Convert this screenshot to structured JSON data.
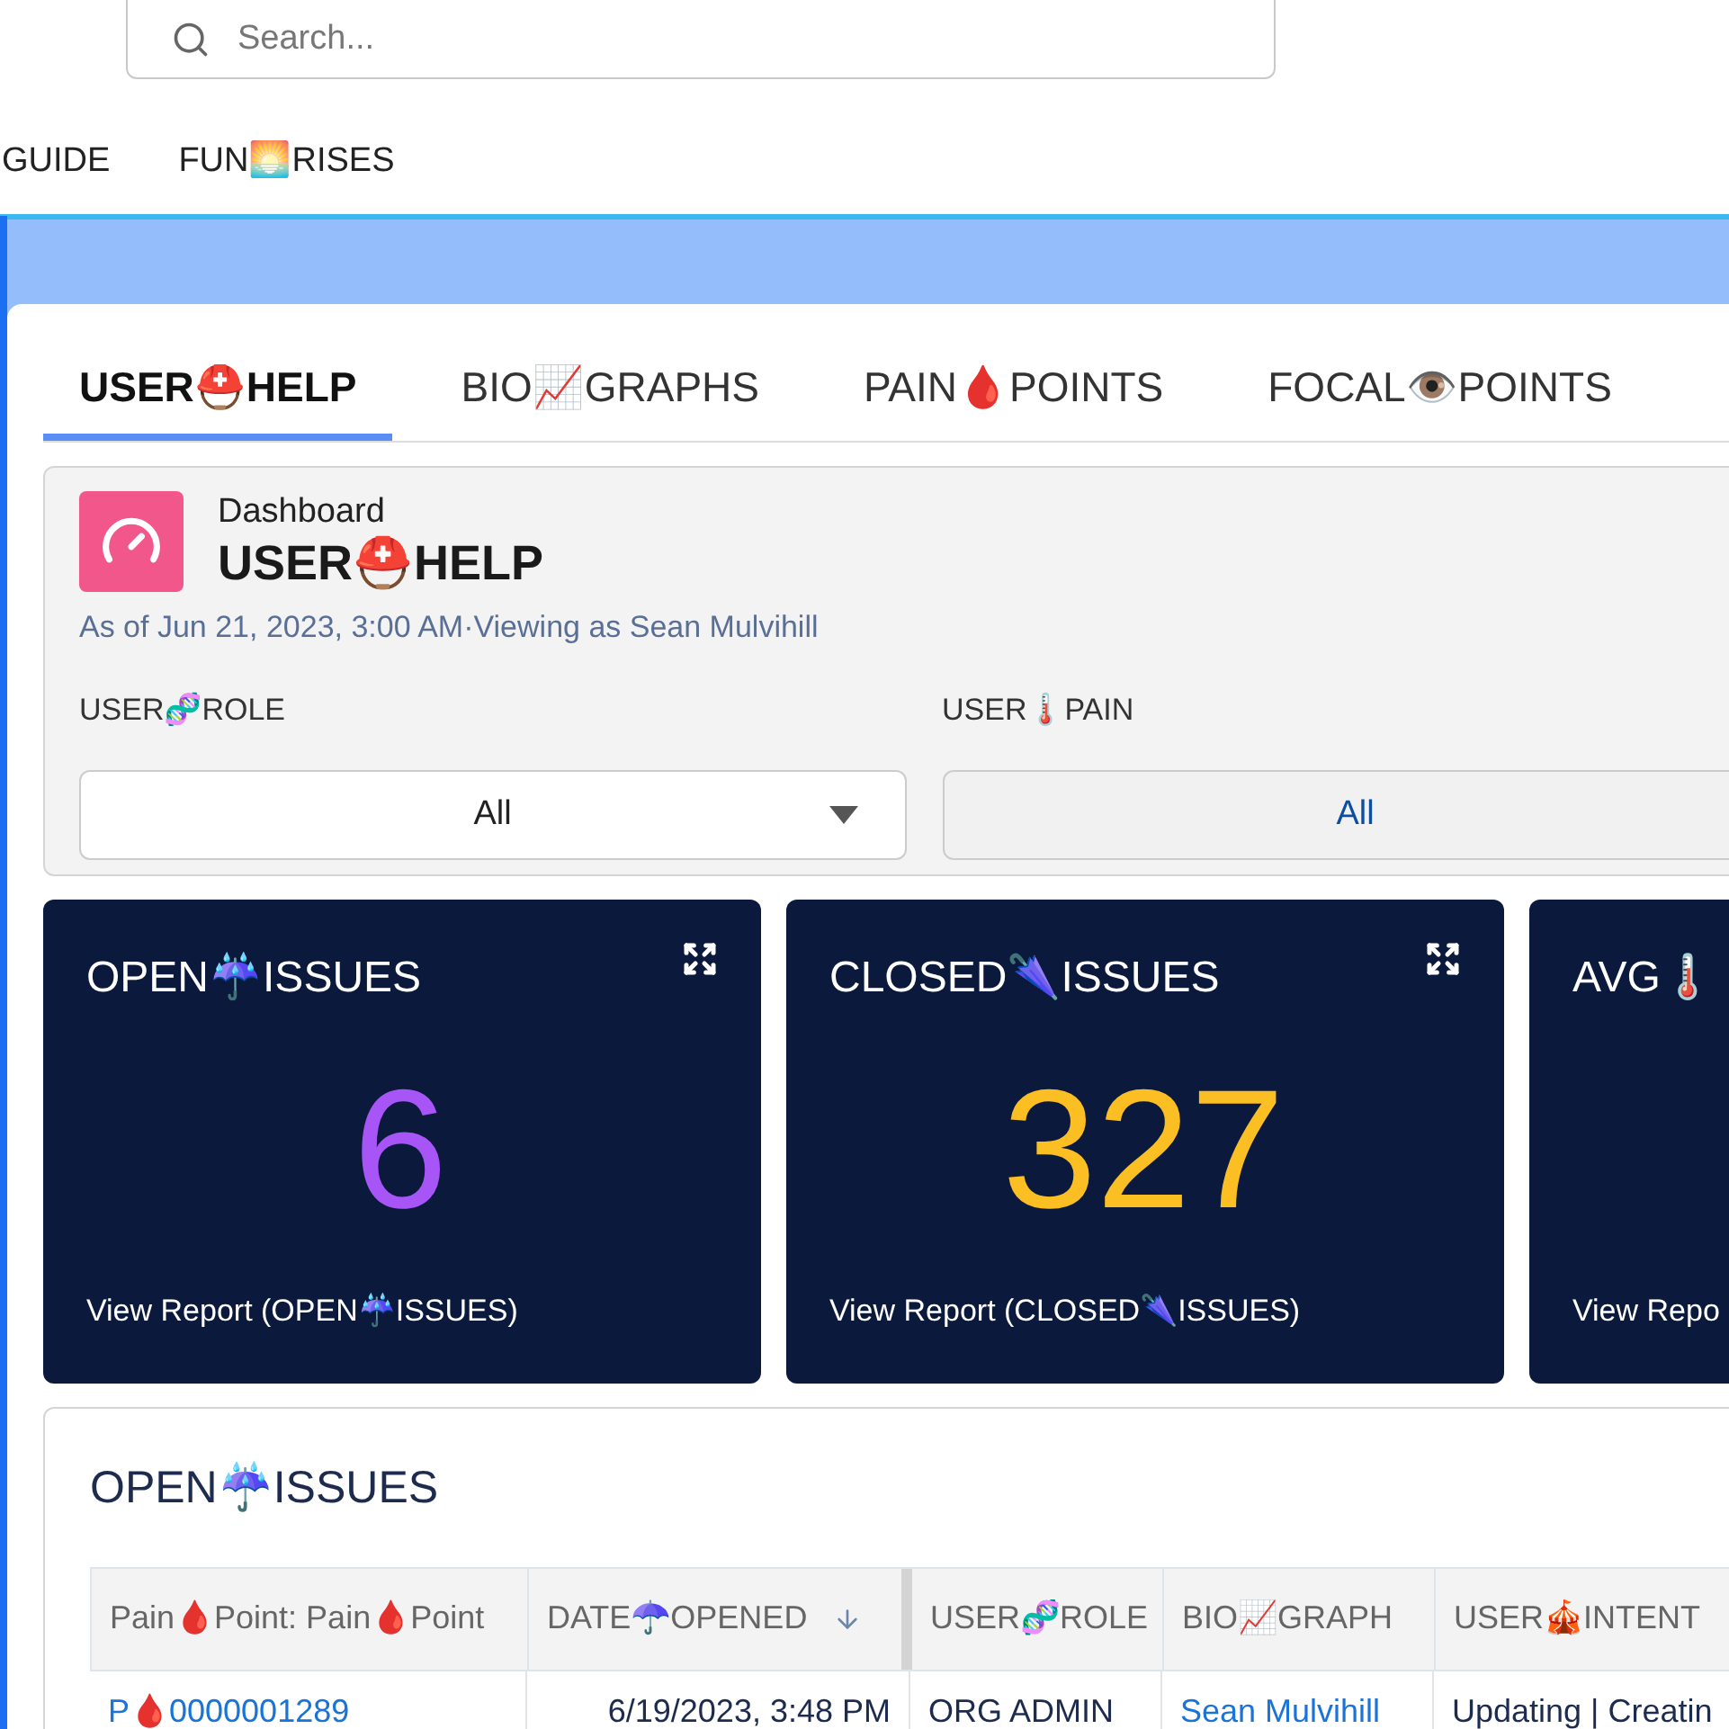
{
  "search": {
    "placeholder": "Search..."
  },
  "nav": [
    {
      "label": "GUIDE"
    },
    {
      "label": "FUN🌅RISES"
    }
  ],
  "tabs": [
    {
      "label": "USER⛑️HELP",
      "selected": true
    },
    {
      "label": "BIO📈GRAPHS",
      "selected": false
    },
    {
      "label": "PAIN🩸POINTS",
      "selected": false
    },
    {
      "label": "FOCAL👁️POINTS",
      "selected": false
    }
  ],
  "dashboard": {
    "kicker": "Dashboard",
    "title": "USER⛑️HELP",
    "subtitle": "As of Jun 21, 2023, 3:00 AM·Viewing as Sean Mulvihill",
    "filters": [
      {
        "label": "USER🧬ROLE",
        "value": "All",
        "kind": "dropdown"
      },
      {
        "label": "USER🌡️PAIN",
        "value": "All",
        "kind": "button"
      }
    ]
  },
  "metrics": [
    {
      "title": "OPEN☔ISSUES",
      "value": "6",
      "color": "#a855f7",
      "link": "View Report (OPEN☔ISSUES)"
    },
    {
      "title": "CLOSED🌂ISSUES",
      "value": "327",
      "color": "#fbbf24",
      "link": "View Report (CLOSED🌂ISSUES)"
    },
    {
      "title": "AVG🌡️",
      "link": "View Repo"
    }
  ],
  "table": {
    "title": "OPEN☔ISSUES",
    "columns": [
      {
        "label": "Pain🩸Point: Pain🩸Point",
        "sorted": false
      },
      {
        "label": "DATE☂️OPENED",
        "sorted": true
      },
      {
        "label": "USER🧬ROLE",
        "sorted": false
      },
      {
        "label": "BIO📈GRAPH",
        "sorted": false
      },
      {
        "label": "USER🎪INTENT",
        "sorted": false
      }
    ],
    "rows": [
      {
        "cells": [
          {
            "text": "P🩸0000001289",
            "link": true
          },
          {
            "text": "6/19/2023, 3:48 PM",
            "link": false
          },
          {
            "text": "ORG ADMIN",
            "link": false
          },
          {
            "text": "Sean Mulvihill",
            "link": true
          },
          {
            "text": "Updating | Creatin",
            "link": false
          }
        ]
      }
    ]
  }
}
